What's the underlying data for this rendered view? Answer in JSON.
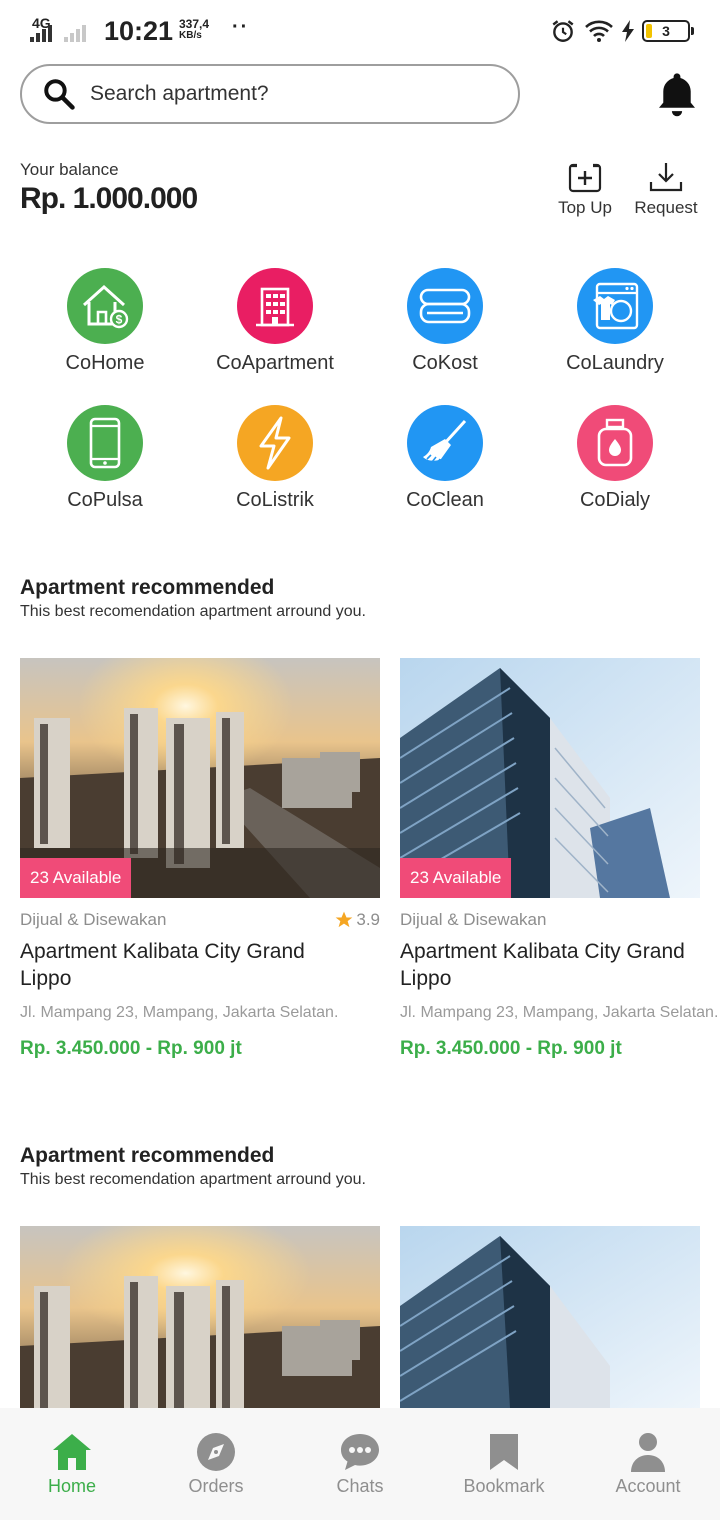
{
  "status_bar": {
    "network": "4G",
    "time": "10:21",
    "speed_value": "337,4",
    "speed_unit": "KB/s",
    "battery": "3"
  },
  "search": {
    "placeholder": "Search apartment?"
  },
  "balance": {
    "label": "Your balance",
    "value": "Rp. 1.000.000",
    "actions": [
      {
        "label": "Top Up",
        "icon": "plus-box-icon"
      },
      {
        "label": "Request",
        "icon": "download-icon"
      }
    ]
  },
  "services": [
    {
      "label": "CoHome",
      "color": "#4caf50",
      "icon": "home-dollar-icon"
    },
    {
      "label": "CoApartment",
      "color": "#e91e63",
      "icon": "building-icon"
    },
    {
      "label": "CoKost",
      "color": "#2196f3",
      "icon": "towel-icon"
    },
    {
      "label": "CoLaundry",
      "color": "#2196f3",
      "icon": "washing-machine-icon"
    },
    {
      "label": "CoPulsa",
      "color": "#4caf50",
      "icon": "phone-icon"
    },
    {
      "label": "CoListrik",
      "color": "#f5a623",
      "icon": "lightning-icon"
    },
    {
      "label": "CoClean",
      "color": "#2196f3",
      "icon": "broom-icon"
    },
    {
      "label": "CoDialy",
      "color": "#f04b78",
      "icon": "gas-cylinder-icon"
    }
  ],
  "sections": [
    {
      "title": "Apartment recommended",
      "subtitle": "This best recomendation apartment arround you.",
      "cards": [
        {
          "badge": "23 Available",
          "category": "Dijual & Disewakan",
          "rating": "3.9",
          "title_line1": "Apartment Kalibata City Grand",
          "title_line2": "Lippo",
          "address": "Jl. Mampang 23, Mampang, Jakarta Selatan.",
          "price": "Rp. 3.450.000 - Rp. 900 jt"
        },
        {
          "badge": "23 Available",
          "category": "Dijual & Disewakan",
          "title_line1": "Apartment Kalibata City Grand",
          "title_line2": "Lippo",
          "address": "Jl. Mampang 23, Mampang, Jakarta Selatan.",
          "price": "Rp. 3.450.000 - Rp. 900 jt"
        }
      ]
    },
    {
      "title": "Apartment recommended",
      "subtitle": "This best recomendation apartment arround you."
    }
  ],
  "bottom_nav": [
    {
      "label": "Home",
      "icon": "home-icon",
      "active": true
    },
    {
      "label": "Orders",
      "icon": "compass-icon"
    },
    {
      "label": "Chats",
      "icon": "chat-bubble-icon"
    },
    {
      "label": "Bookmark",
      "icon": "bookmark-icon"
    },
    {
      "label": "Account",
      "icon": "person-icon"
    }
  ],
  "colors": {
    "accent_green": "#3cae4a",
    "badge_pink": "#f04b78",
    "nav_inactive": "#8f8f8f"
  }
}
